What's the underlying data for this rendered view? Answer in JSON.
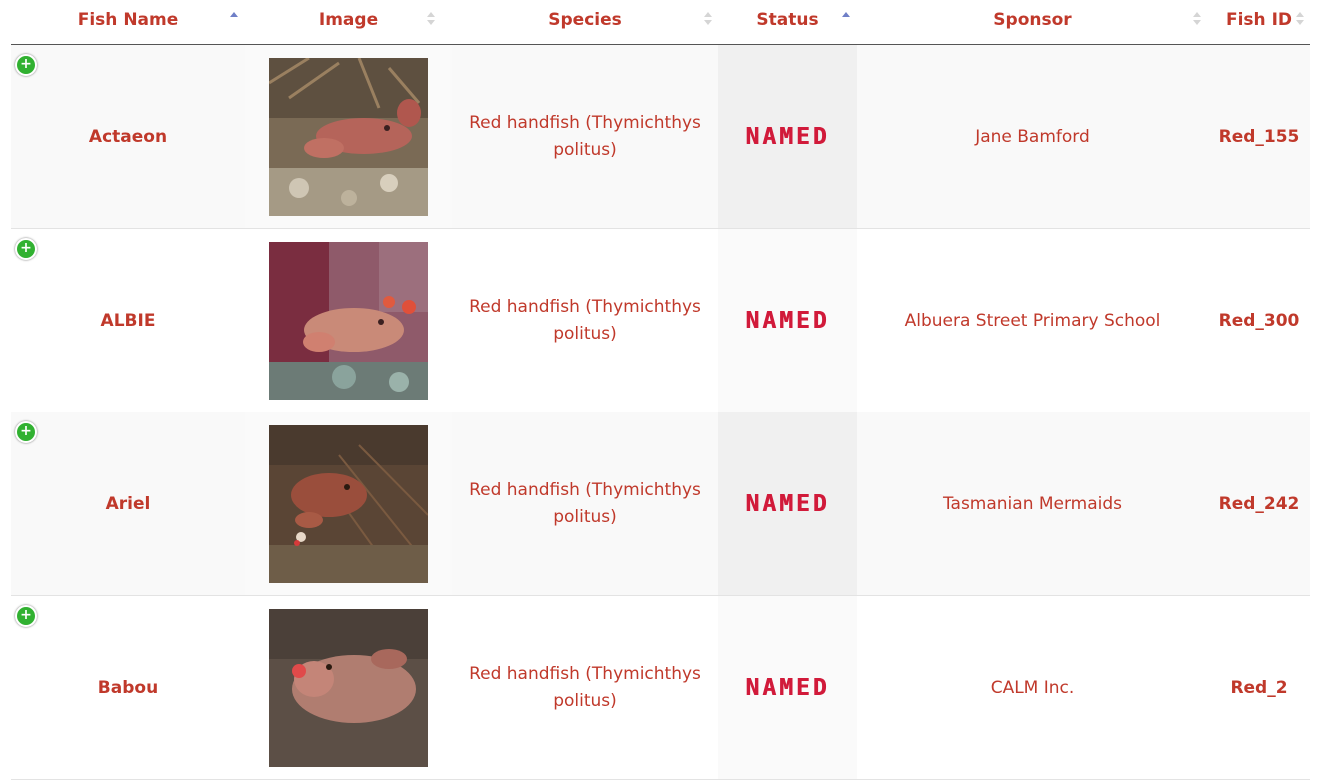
{
  "table": {
    "headers": [
      {
        "label": "Fish Name",
        "sort": "asc"
      },
      {
        "label": "Image",
        "sort": "none"
      },
      {
        "label": "Species",
        "sort": "none"
      },
      {
        "label": "Status",
        "sort": "asc"
      },
      {
        "label": "Sponsor",
        "sort": "none"
      },
      {
        "label": "Fish ID",
        "sort": "none"
      }
    ],
    "rows": [
      {
        "name": "Actaeon",
        "species": "Red handfish (Thymichthys politus)",
        "status": "NAMED",
        "sponsor": "Jane Bamford",
        "fish_id": "Red_155",
        "expand": "+",
        "image": "red-handfish-photo"
      },
      {
        "name": "ALBIE",
        "species": "Red handfish (Thymichthys politus)",
        "status": "NAMED",
        "sponsor": "Albuera Street Primary School",
        "fish_id": "Red_300",
        "expand": "+",
        "image": "red-handfish-photo"
      },
      {
        "name": "Ariel",
        "species": "Red handfish (Thymichthys politus)",
        "status": "NAMED",
        "sponsor": "Tasmanian Mermaids",
        "fish_id": "Red_242",
        "expand": "+",
        "image": "red-handfish-photo"
      },
      {
        "name": "Babou",
        "species": "Red handfish (Thymichthys politus)",
        "status": "NAMED",
        "sponsor": "CALM Inc.",
        "fish_id": "Red_2",
        "expand": "+",
        "image": "red-handfish-photo"
      }
    ]
  },
  "colors": {
    "text": "#c0392b",
    "stamp": "#d11a3a",
    "expand_button": "#31b131",
    "sort_active": "#6f7fc7"
  }
}
